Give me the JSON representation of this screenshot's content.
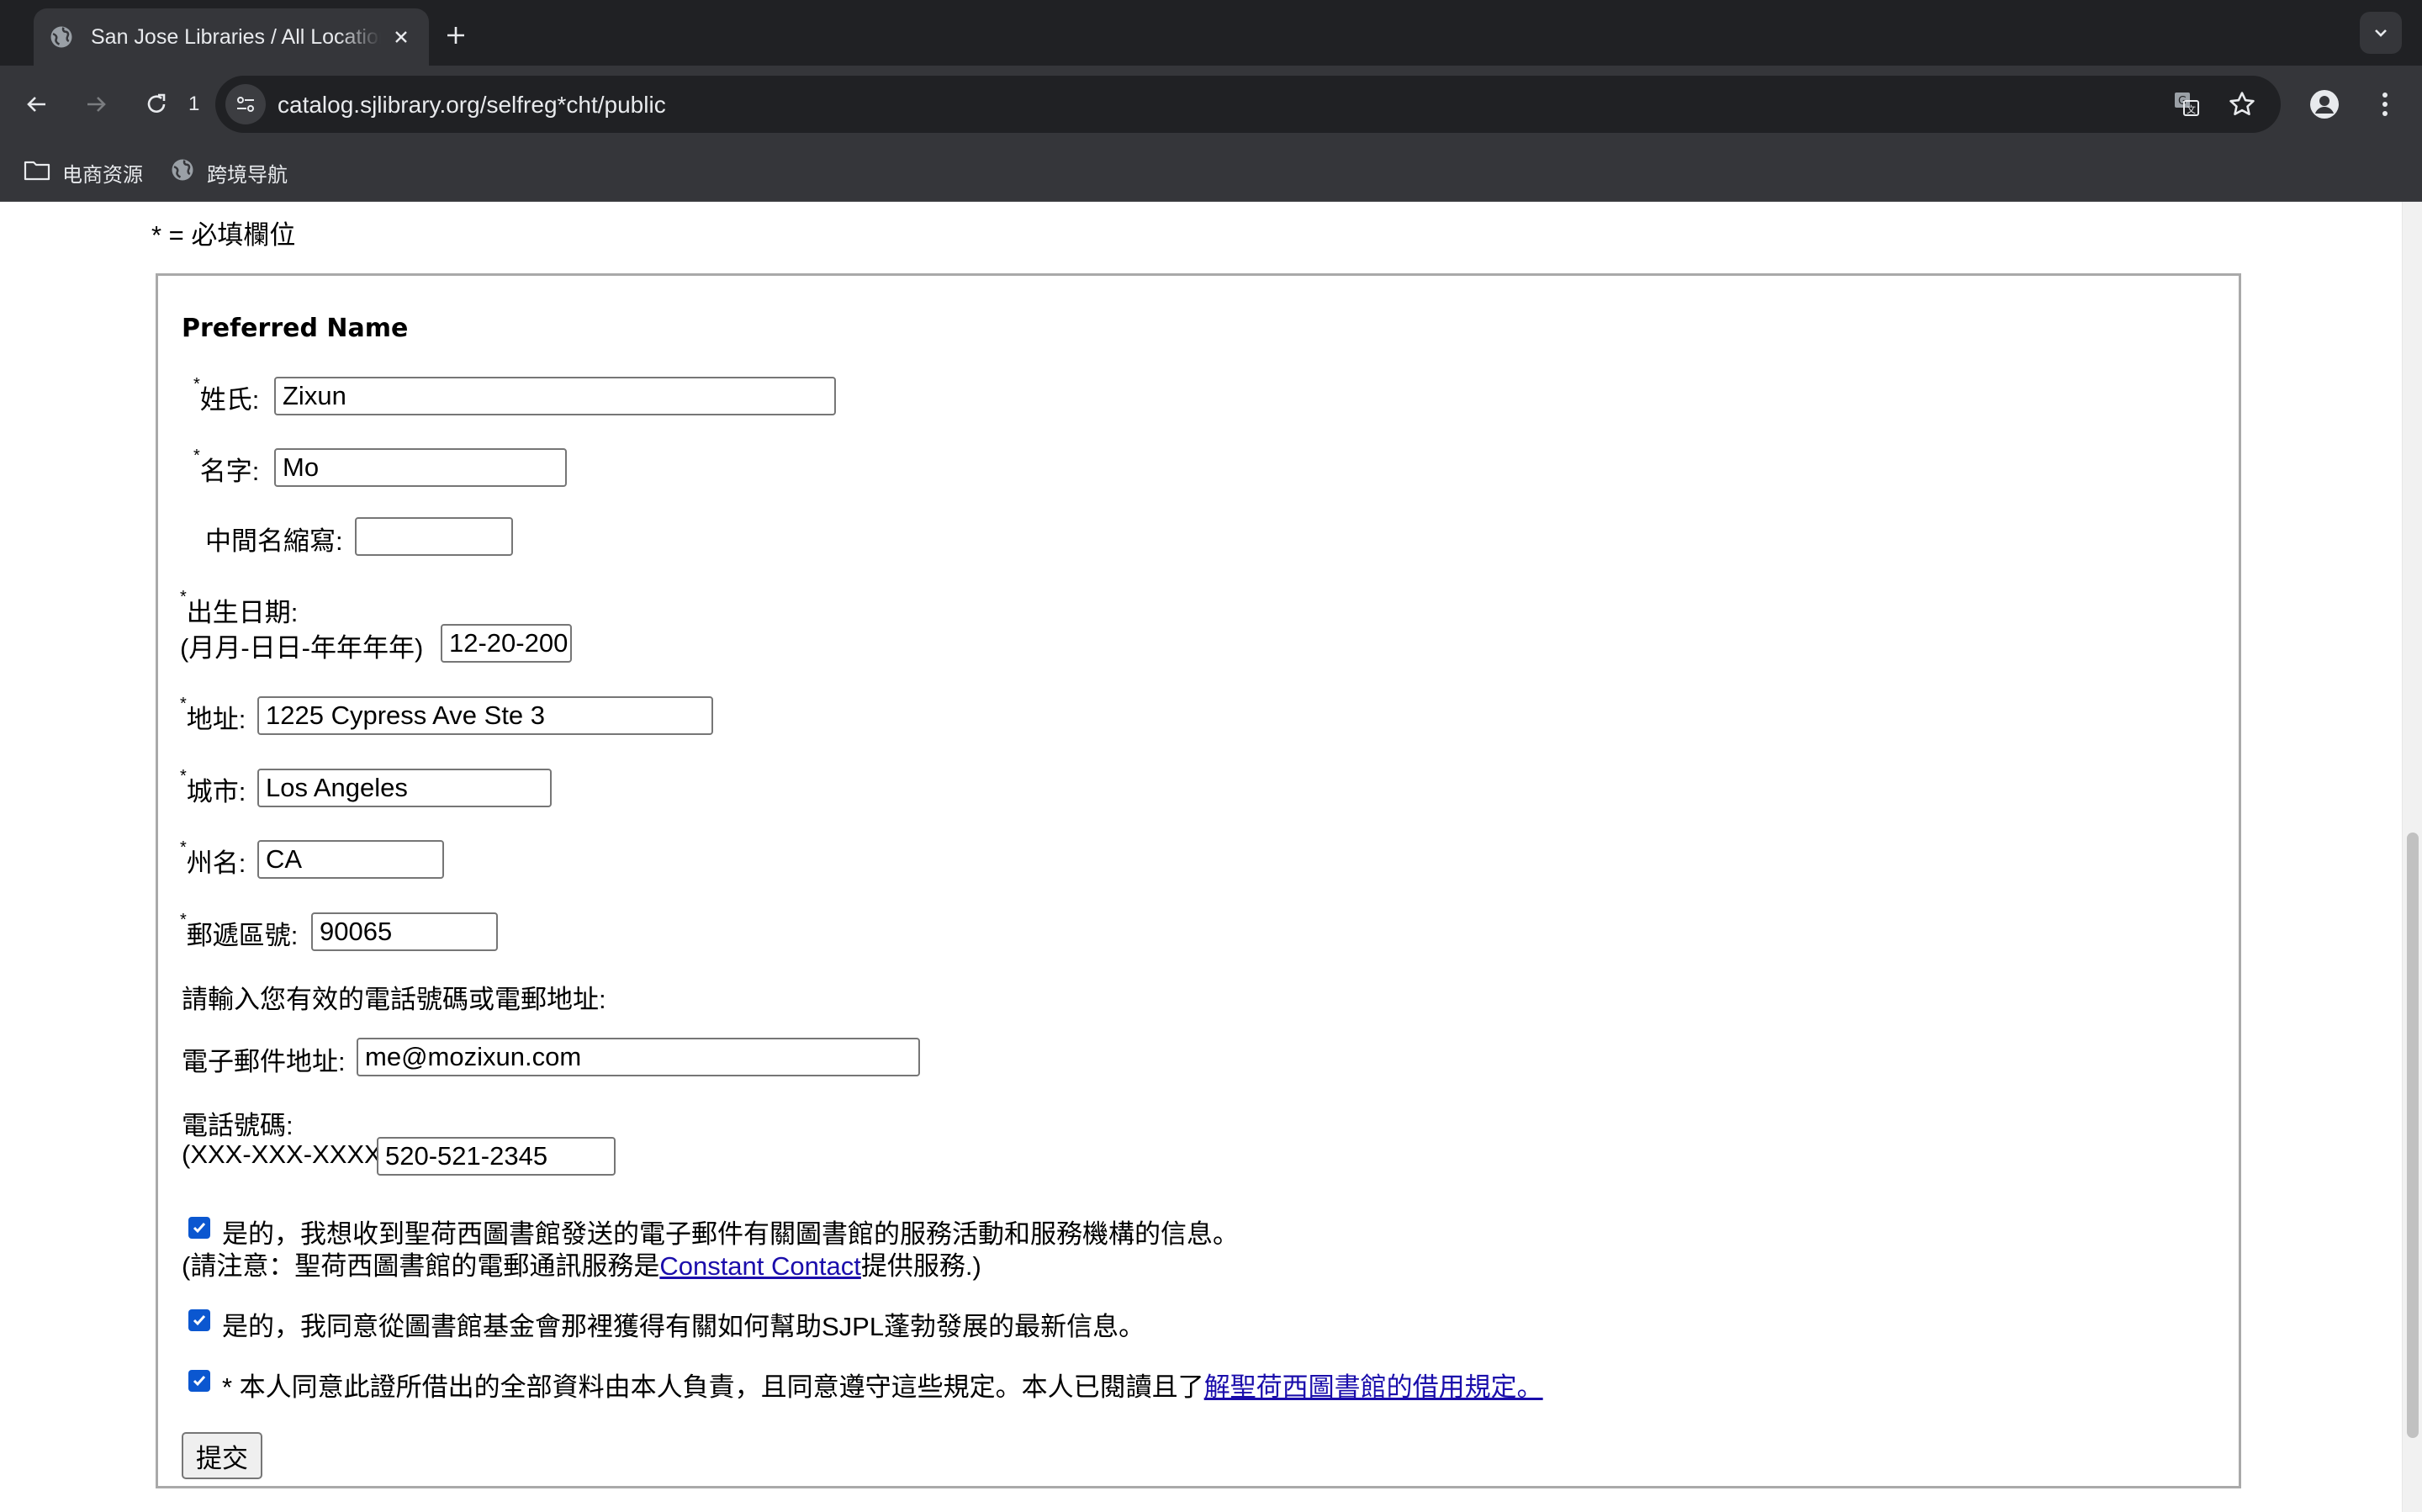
{
  "browser": {
    "tab_title": "San Jose Libraries / All Locations",
    "reload_count": "1",
    "url": "catalog.sjlibrary.org/selfreg*cht/public",
    "bookmarks": [
      {
        "label": "电商资源",
        "icon": "folder-icon"
      },
      {
        "label": "跨境导航",
        "icon": "globe-icon"
      }
    ]
  },
  "form": {
    "required_note": "* = 必填欄位",
    "section_heading": "Preferred Name",
    "required_mark": "*",
    "last_name": {
      "label": "姓氏:",
      "value": "Zixun"
    },
    "first_name": {
      "label": "名字:",
      "value": "Mo"
    },
    "middle_initial": {
      "label": "中間名縮寫:",
      "value": ""
    },
    "birth_date": {
      "label": "出生日期:",
      "format": "(月月-日日-年年年年)",
      "value": "12-20-200"
    },
    "address": {
      "label": "地址:",
      "value": "1225 Cypress Ave Ste 3"
    },
    "city": {
      "label": "城市:",
      "value": "Los Angeles"
    },
    "state": {
      "label": "州名:",
      "value": "CA"
    },
    "zip": {
      "label": "郵遞區號:",
      "value": "90065"
    },
    "contact_prompt": "請輸入您有效的電話號碼或電郵地址:",
    "email": {
      "label": "電子郵件地址:",
      "value": "me@mozixun.com"
    },
    "phone": {
      "label": "電話號碼:",
      "format": "(XXX-XXX-XXXX)",
      "value": "520-521-2345"
    },
    "checkbox_newsletter": {
      "checked": true,
      "label": "是的，我想收到聖荷西圖書館發送的電子郵件有關圖書館的服務活動和服務機構的信息。",
      "note_prefix": "(請注意：聖荷西圖書館的電郵通訊服務是",
      "note_link": "Constant Contact",
      "note_suffix": "提供服務.)"
    },
    "checkbox_foundation": {
      "checked": true,
      "label": "是的，我同意從圖書館基金會那裡獲得有關如何幫助SJPL蓬勃發展的最新信息。"
    },
    "checkbox_agreement": {
      "checked": true,
      "label": "* 本人同意此證所借出的全部資料由本人負責，且同意遵守這些規定。本人已閱讀且了",
      "link": "解聖荷西圖書館的借用規定。"
    },
    "submit_label": "提交"
  },
  "colors": {
    "chrome_dark": "#202124",
    "chrome_toolbar": "#35363a",
    "checkbox_blue": "#0b57d0",
    "link": "#1a0dab"
  }
}
